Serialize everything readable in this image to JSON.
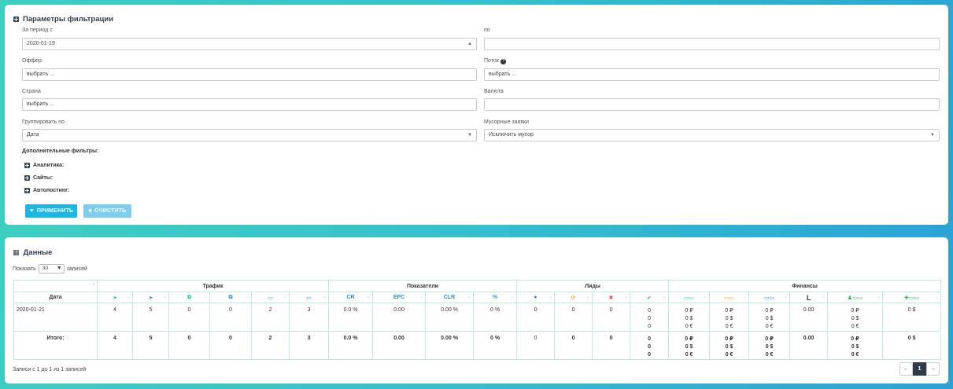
{
  "filters": {
    "title": "Параметры фильтрации",
    "period_from_label": "За период с",
    "period_from_value": "2020-01-19",
    "period_to_label": "по",
    "period_to_value": "",
    "offer_label": "Оффер:",
    "offer_placeholder": "выбрать ...",
    "stream_label": "Поток",
    "stream_placeholder": "выбрать ...",
    "country_label": "Страна",
    "country_placeholder": "выбрать ...",
    "currency_label": "Валюта",
    "currency_value": "",
    "group_label": "Группировать по",
    "group_value": "Дата",
    "trash_label": "Мусорные заявки",
    "trash_value": "Исключить мусор",
    "extra_label": "Дополнительные фильтры:",
    "extra_items": [
      "Аналитика:",
      "Сайты:",
      "Автопостинг:"
    ],
    "apply_label": "ПРИМЕНИТЬ",
    "clear_label": "ОЧИСТИТЬ"
  },
  "data": {
    "title": "Данные",
    "show_label": "Показать",
    "show_value": "30",
    "show_suffix": "записей",
    "groups": {
      "traffic": "Трафик",
      "metrics": "Показатели",
      "leads": "Лиды",
      "finance": "Финансы"
    },
    "date_header": "Дата",
    "metric_headers": [
      "CR",
      "EPC",
      "CLR",
      "%"
    ],
    "rows": [
      {
        "date": "2020-01-21",
        "traffic": [
          "4",
          "5",
          "0",
          "0",
          "2",
          "3"
        ],
        "metrics": [
          "0.0 %",
          "0.00",
          "0.00 %",
          "0 %"
        ],
        "leads": [
          "0",
          "0",
          "0"
        ],
        "leads_last": [
          "0",
          "0",
          "0"
        ],
        "fin1": [
          "0 ₽",
          "0 $",
          "0 €"
        ],
        "fin2": [
          "0 ₽",
          "0 $",
          "0 €"
        ],
        "fin3": [
          "0 ₽",
          "0 $",
          "0 €"
        ],
        "fin4": "0.00",
        "fin5": [
          "0 ₽",
          "0 $",
          "0 €"
        ],
        "fin6": "0 $"
      },
      {
        "date": "Итого:",
        "traffic": [
          "4",
          "5",
          "0",
          "0",
          "2",
          "3"
        ],
        "metrics": [
          "0.0 %",
          "0.00",
          "0.00 %",
          "0 %"
        ],
        "leads": [
          "0",
          "0",
          "0"
        ],
        "leads_last": [
          "0",
          "0",
          "0"
        ],
        "fin1": [
          "0 ₽",
          "0 $",
          "0 €"
        ],
        "fin2": [
          "0 ₽",
          "0 $",
          "0 €"
        ],
        "fin3": [
          "0 ₽",
          "0 $",
          "0 €"
        ],
        "fin4": "0.00",
        "fin5": [
          "0 ₽",
          "0 $",
          "0 €"
        ],
        "fin6": "0 $"
      }
    ],
    "footer_info": "Записи с 1 до 1 из 1 записей",
    "pager": {
      "prev": "←",
      "page": "1",
      "next": "→"
    }
  },
  "colors": {
    "accent": "#1cb7e3",
    "header_text": "#2f3b4c",
    "table_border": "#bfe6e6"
  }
}
